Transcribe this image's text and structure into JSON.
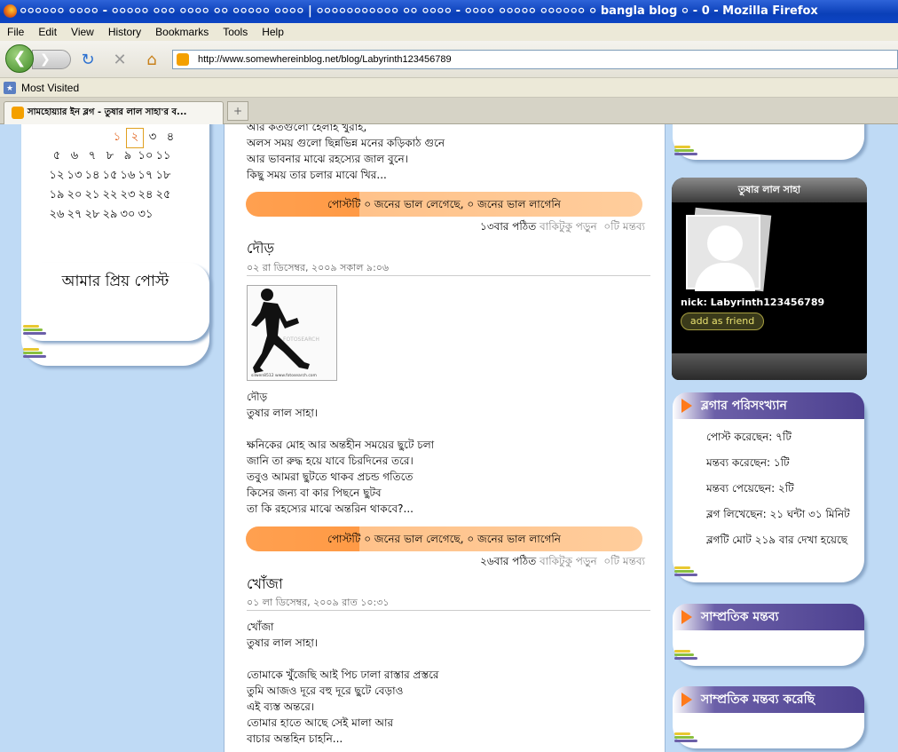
{
  "window": {
    "title": "০০০০০০ ০০০০ - ০০০০০ ০০০ ০০০০ ০০ ০০০০০ ০০০০ | ০০০০০০০০০০০ ০০ ০০০০ - ০০০০ ০০০০০ ০০০০০০ ০ bangla blog ০ - 0 - Mozilla Firefox"
  },
  "menu": [
    "File",
    "Edit",
    "View",
    "History",
    "Bookmarks",
    "Tools",
    "Help"
  ],
  "toolbar": {
    "url": "http://www.somewhereinblog.net/blog/Labyrinth123456789",
    "back": "❮",
    "forward": "❯"
  },
  "bookmarks": {
    "most_visited": "Most Visited"
  },
  "tab": {
    "title": "সামহোয়্যার ইন ব্লগ - তুষার লাল সাহা'র ব...",
    "new_tab": "+"
  },
  "calendar": {
    "rows": [
      [
        "১",
        "২",
        "৩",
        "৪"
      ],
      [
        "৫",
        "৬",
        "৭",
        "৮",
        "৯",
        "১০",
        "১১"
      ],
      [
        "১২",
        "১৩",
        "১৪",
        "১৫",
        "১৬",
        "১৭",
        "১৮"
      ],
      [
        "১৯",
        "২০",
        "২১",
        "২২",
        "২৩",
        "২৪",
        "২৫"
      ],
      [
        "২৬",
        "২৭",
        "২৮",
        "২৯",
        "৩০",
        "৩১"
      ]
    ]
  },
  "favorites": {
    "title": "আমার প্রিয় পোস্ট"
  },
  "posts": [
    {
      "lines": [
        "আর কতগুলো হেলাহ খুরাহ,",
        "অলস সময় গুলো ছিন্নভিন্ন মনের কড়িকাঠ গুনে",
        "আর ভাবনার মাঝে রহস্যের জাল বুনে।",
        "কিছু সময় তার চলার মাঝে খির..."
      ],
      "likes": "পোস্টটি ০ জনের ভাল লেগেছে, ০ জনের ভাল লাগেনি",
      "reads": "১৩বার পঠিত",
      "read_more": "বাকিটুকু পড়ুন",
      "comments": "০টি মন্তব্য"
    },
    {
      "title": "দৌড়",
      "date": "০২ রা ডিসেম্বর, ২০০৯ সকাল ৯:০৬",
      "image_caption": "silwen8512 www.fotosearch.com",
      "watermark": "FOTOSEARCH",
      "lines": [
        "দৌড়",
        "তুষার লাল সাহা।",
        "",
        "ক্ষনিকের মোহ আর অন্তহীন সময়ের ছুটে চলা",
        "জানি তা রুদ্ধ হয়ে যাবে চিরদিনের তরে।",
        "তবুও আমরা ছুটতে থাকব প্রচন্ড গতিতে",
        "কিসের জন্য বা কার পিছনে ছুটব",
        "তা কি রহস্যের মাঝে অন্তরিন থাকবে?..."
      ],
      "likes": "পোস্টটি ০ জনের ভাল লেগেছে, ০ জনের ভাল লাগেনি",
      "reads": "২৬বার পঠিত",
      "read_more": "বাকিটুকু পড়ুন",
      "comments": "০টি মন্তব্য"
    },
    {
      "title": "খোঁজা",
      "date": "০১ লা ডিসেম্বর, ২০০৯ রাত ১০:৩১",
      "lines": [
        "খোঁজা",
        "তুষার লাল সাহা।",
        "",
        "তোমাকে খুঁজেছি আই পিচ ঢালা রাস্তার প্রস্তরে",
        "তুমি আজও দূরে বহু দূরে ছুটে বেড়াও",
        "এই ব্যস্ত অন্তরে।",
        "তোমার হাতে আছে সেই মালা আর",
        "বাচার অন্তহিন চাহনি..."
      ]
    }
  ],
  "profile": {
    "header": "তুষার লাল সাহা",
    "nick": "nick: Labyrinth123456789",
    "add_friend": "add as friend"
  },
  "stats": {
    "title": "ব্লগার পরিসংখ্যান",
    "items": [
      "পোস্ট করেছেন: ৭টি",
      "মন্তব্য করেছেন: ১টি",
      "মন্তব্য পেয়েছেন: ২টি",
      "ব্লগ লিখেছেন: ২১ ঘন্টা ৩১ মিনিট",
      "ব্লগটি মোট ২১৯ বার দেখা হয়েছে"
    ]
  },
  "recent_comments": {
    "title": "সাম্প্রতিক মন্তব্য"
  },
  "my_recent_comments": {
    "title": "সাম্প্রতিক মন্তব্য করেছি"
  },
  "colors": {
    "accent": "#ff9a45",
    "header_purple": "#4d4190",
    "page_bg": "#bfdaf5"
  }
}
